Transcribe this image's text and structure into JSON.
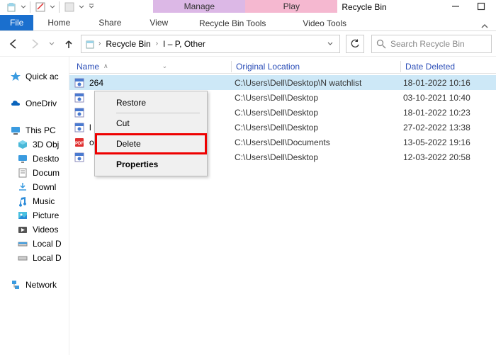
{
  "titlebar": {
    "title": "Recycle Bin"
  },
  "ribbon": {
    "file": "File",
    "tabs": [
      "Home",
      "Share",
      "View"
    ],
    "ctx": [
      {
        "header": "Manage",
        "sub": "Recycle Bin Tools"
      },
      {
        "header": "Play",
        "sub": "Video Tools"
      }
    ]
  },
  "address": {
    "crumbs": [
      "Recycle Bin",
      "I – P, Other"
    ],
    "search_placeholder": "Search Recycle Bin"
  },
  "sidebar": {
    "quick": "Quick ac",
    "onedrive": "OneDriv",
    "thispc": "This PC",
    "thispc_items": [
      "3D Obj",
      "Deskto",
      "Docum",
      "Downl",
      "Music",
      "Picture",
      "Videos",
      "Local D",
      "Local D"
    ],
    "network": "Network"
  },
  "columns": {
    "name": "Name",
    "orig": "Original Location",
    "date": "Date Deleted"
  },
  "rows": [
    {
      "name": "264",
      "orig": "C:\\Users\\Dell\\Desktop\\N watchlist",
      "date": "18-01-2022 10:16",
      "icon": "video",
      "sel": true
    },
    {
      "name": "",
      "orig": "C:\\Users\\Dell\\Desktop",
      "date": "03-10-2021 10:40",
      "icon": "video"
    },
    {
      "name": "",
      "orig": "C:\\Users\\Dell\\Desktop",
      "date": "18-01-2022 10:23",
      "icon": "video"
    },
    {
      "name": "l H...",
      "orig": "C:\\Users\\Dell\\Desktop",
      "date": "27-02-2022 13:38",
      "icon": "video"
    },
    {
      "name": "orm...",
      "orig": "C:\\Users\\Dell\\Documents",
      "date": "13-05-2022 19:16",
      "icon": "pdf"
    },
    {
      "name": "",
      "orig": "C:\\Users\\Dell\\Desktop",
      "date": "12-03-2022 20:58",
      "icon": "video"
    }
  ],
  "context_menu": {
    "restore": "Restore",
    "cut": "Cut",
    "delete": "Delete",
    "properties": "Properties"
  }
}
